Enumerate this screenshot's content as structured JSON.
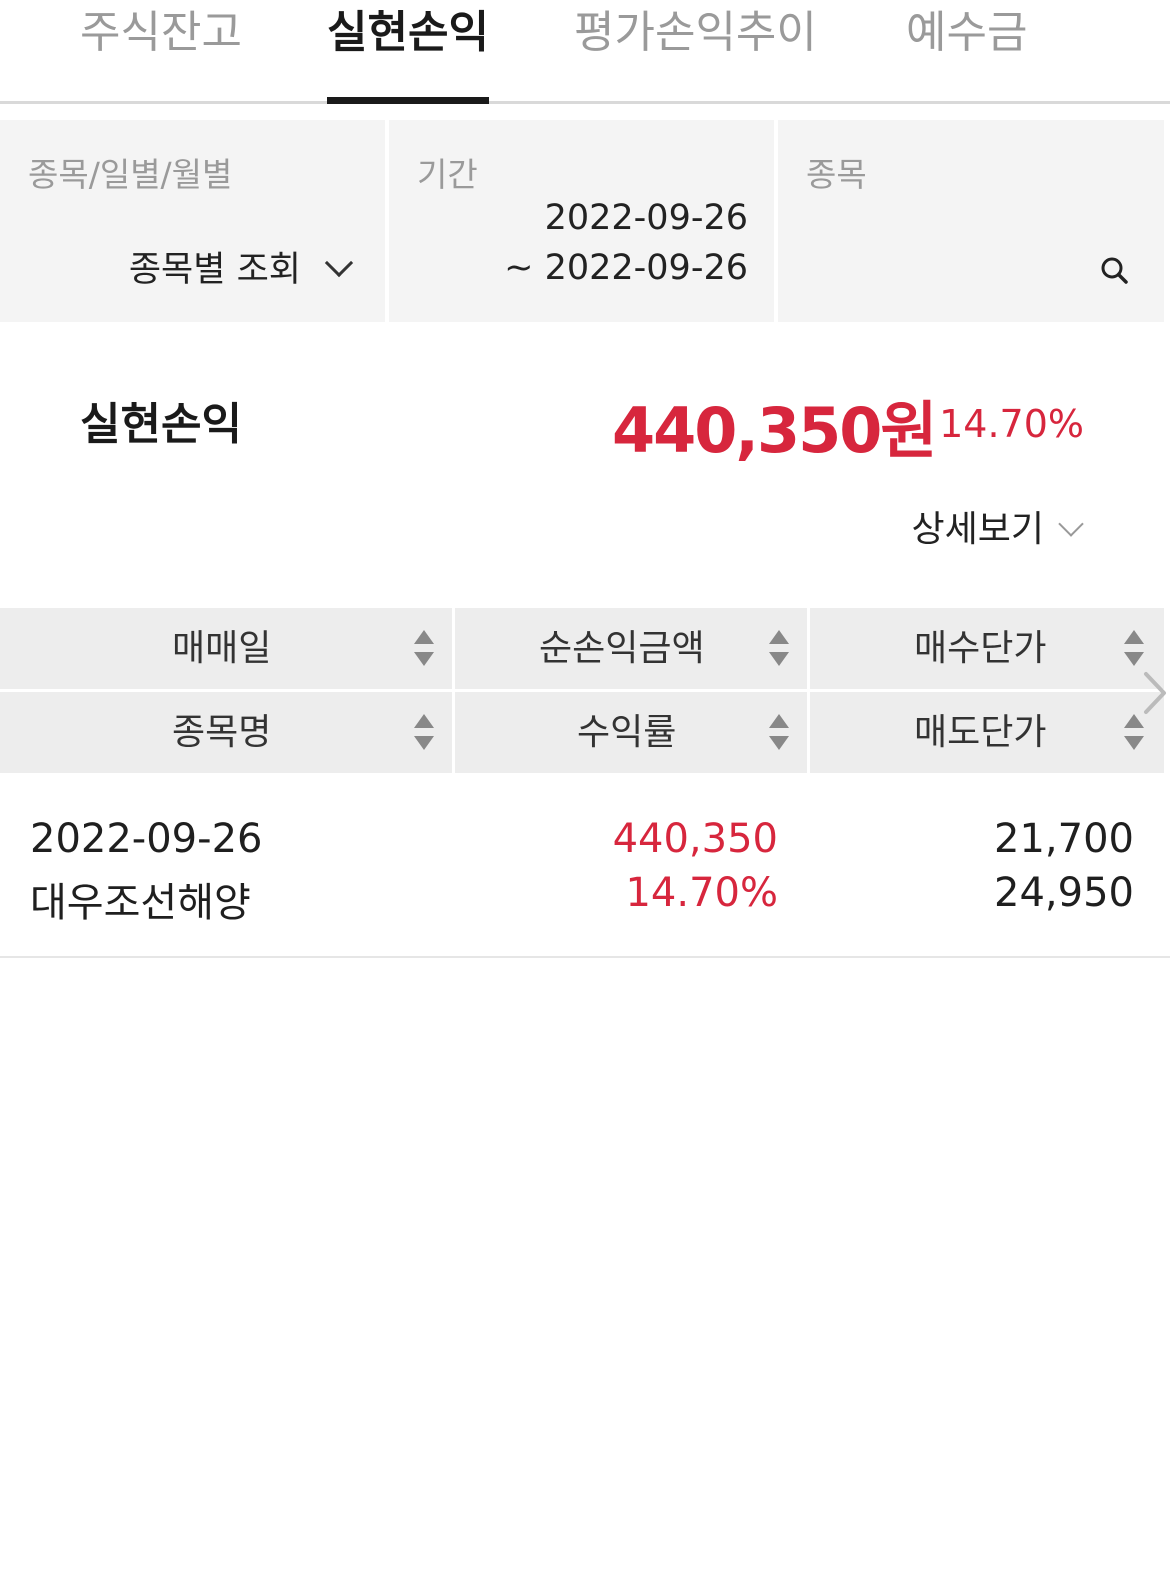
{
  "tabs": [
    {
      "label": "주식잔고",
      "active": false
    },
    {
      "label": "실현손익",
      "active": true
    },
    {
      "label": "평가손익추이",
      "active": false
    },
    {
      "label": "예수금",
      "active": false
    }
  ],
  "filters": {
    "view_mode": {
      "label": "종목/일별/월별",
      "value": "종목별 조회"
    },
    "period": {
      "label": "기간",
      "start": "2022-09-26",
      "end": "~ 2022-09-26"
    },
    "stock": {
      "label": "종목",
      "value": ""
    }
  },
  "summary": {
    "title": "실현손익",
    "amount": "440,350원",
    "rate": "14.70%",
    "detail_label": "상세보기"
  },
  "table": {
    "headers_row1": [
      "매매일",
      "순손익금액",
      "매수단가"
    ],
    "headers_row2": [
      "종목명",
      "수익률",
      "매도단가"
    ],
    "rows": [
      {
        "trade_date": "2022-09-26",
        "stock_name": "대우조선해양",
        "net_profit": "440,350",
        "profit_rate": "14.70%",
        "buy_price": "21,700",
        "sell_price": "24,950"
      }
    ]
  },
  "colors": {
    "accent_red": "#d7263d",
    "header_bg": "#ededed",
    "filter_bg": "#f4f4f4"
  }
}
